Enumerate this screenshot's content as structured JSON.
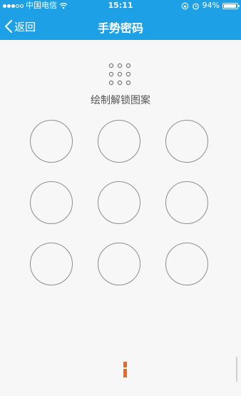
{
  "status_bar": {
    "carrier": "中国电信",
    "time": "15:11",
    "battery_percent": "94%",
    "battery_level": 0.94,
    "signal_dots": [
      true,
      true,
      true,
      false,
      false
    ]
  },
  "nav": {
    "back_label": "返回",
    "title": "手势密码"
  },
  "main": {
    "hint": "绘制解锁图案",
    "nodes": [
      1,
      2,
      3,
      4,
      5,
      6,
      7,
      8,
      9
    ]
  },
  "icons": {
    "back": "chevron-left-icon",
    "wifi": "wifi-icon",
    "lock": "rotation-lock-icon",
    "alarm": "alarm-icon",
    "pattern": "pattern-grid-icon"
  },
  "colors": {
    "header": "#1ea0e6",
    "node_border": "#8e8e8e",
    "accent": "#f26522"
  }
}
